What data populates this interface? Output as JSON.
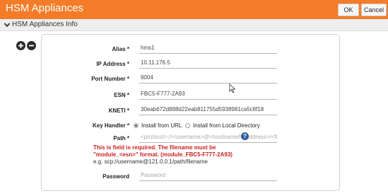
{
  "window": {
    "title": "HSM Appliances",
    "ok_label": "OK",
    "cancel_label": "Cancel"
  },
  "section": {
    "title": "HSM Appliances Info",
    "icon": "chevron-down-icon"
  },
  "row_controls": {
    "add_icon": "plus-circle-icon",
    "remove_icon": "minus-circle-icon"
  },
  "form": {
    "alias": {
      "label": "Alias *",
      "value": "hms1"
    },
    "ip_address": {
      "label": "IP Address *",
      "value": "10.11.176.5"
    },
    "port_number": {
      "label": "Port Number *",
      "value": "9004"
    },
    "esn": {
      "label": "ESN *",
      "value": "FBC5-F777-2A93"
    },
    "kneti": {
      "label": "KNETI *",
      "value": "30eab672d888d22eab811755d5938981ca5c8f18"
    },
    "key_handler": {
      "label": "Key Handler *",
      "options": [
        "Install from URL",
        "Install from Local Directory"
      ],
      "selected": "Install from URL"
    },
    "path": {
      "label": "Path *",
      "placeholder": "<protocol>://<username>@<hostname/IP address>/<file p",
      "help_icon": "question-circle-icon",
      "error_line1": "This is field is required. The filename must be",
      "error_line2": "\"module_<esn>\" format. (module_FBC5-F777-2A93)",
      "example": "e.g. scp://username@121.0.0.1/path/filename"
    },
    "password": {
      "label": "Password",
      "placeholder": "Password"
    }
  },
  "colors": {
    "titlebar": "#f47c28",
    "error": "#cc1f1f",
    "help_icon": "#2f5f9e"
  }
}
